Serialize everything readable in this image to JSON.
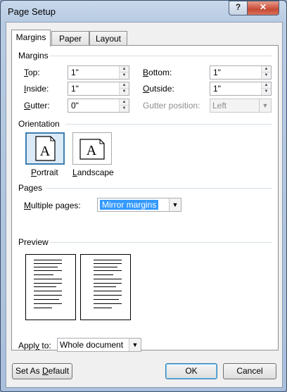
{
  "window": {
    "title": "Page Setup",
    "help_label": "?",
    "close_label": "✕"
  },
  "tabs": [
    {
      "label": "Margins",
      "active": true
    },
    {
      "label": "Paper",
      "active": false
    },
    {
      "label": "Layout",
      "active": false
    }
  ],
  "margins": {
    "section_label": "Margins",
    "top": {
      "label": "Top:",
      "value": "1\""
    },
    "bottom": {
      "label": "Bottom:",
      "value": "1\""
    },
    "inside": {
      "label": "Inside:",
      "value": "1\""
    },
    "outside": {
      "label": "Outside:",
      "value": "1\""
    },
    "gutter": {
      "label": "Gutter:",
      "value": "0\""
    },
    "gutter_position": {
      "label": "Gutter position:",
      "value": "Left",
      "enabled": false
    }
  },
  "orientation": {
    "section_label": "Orientation",
    "portrait_label": "Portrait",
    "landscape_label": "Landscape",
    "selected": "Portrait",
    "icon_letter": "A"
  },
  "pages": {
    "section_label": "Pages",
    "multiple_pages_label": "Multiple pages:",
    "multiple_pages_value": "Mirror margins"
  },
  "preview": {
    "section_label": "Preview"
  },
  "apply_to": {
    "label": "Apply to:",
    "value": "Whole document"
  },
  "buttons": {
    "set_default": "Set As Default",
    "ok": "OK",
    "cancel": "Cancel"
  },
  "colors": {
    "selection": "#3399ff",
    "accent": "#3c7fb1",
    "close": "#c64a34"
  }
}
